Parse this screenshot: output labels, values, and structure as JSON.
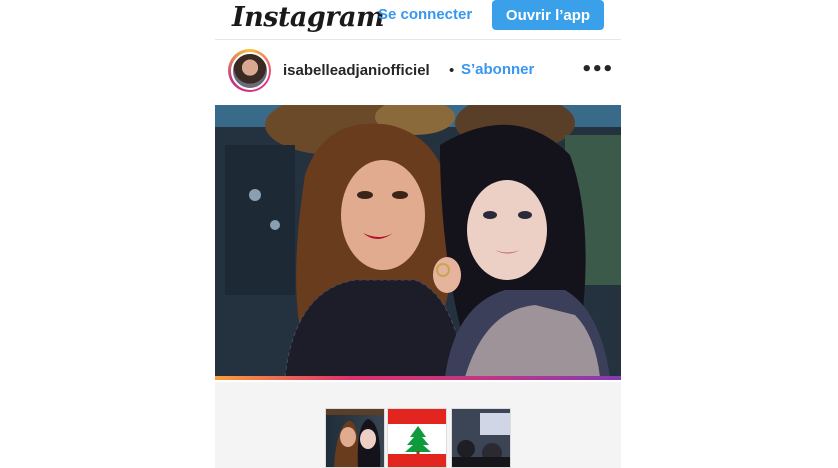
{
  "header": {
    "logo_text": "Instagram",
    "login_label": "Se connecter",
    "open_app_label": "Ouvrir l’app"
  },
  "post": {
    "username": "isabelleadjaniofficiel",
    "separator": "•",
    "follow_label": "S’abonner",
    "more_label": "•••"
  },
  "colors": {
    "accent_blue": "#3897f0",
    "button_blue": "#3aa0ea"
  },
  "carousel": {
    "thumbnails": [
      "photo-two-women",
      "lebanon-flag",
      "photo-crowd"
    ]
  }
}
